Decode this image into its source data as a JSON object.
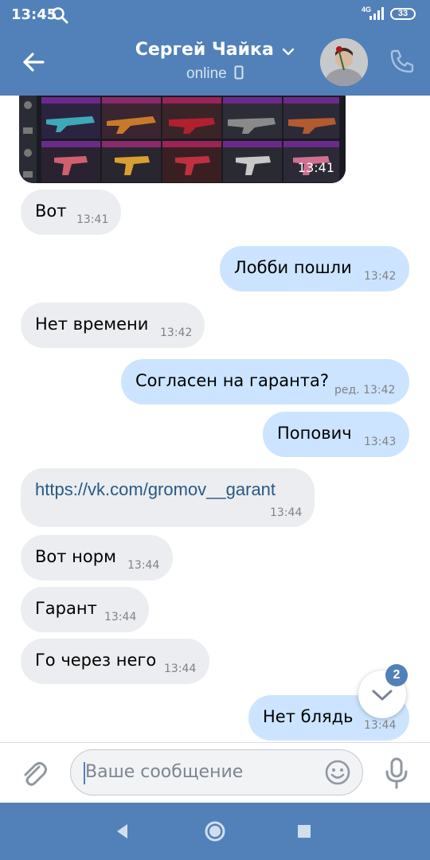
{
  "status_bar": {
    "time": "13:45",
    "network": "4G",
    "battery": "33"
  },
  "header": {
    "title": "Сергей Чайка",
    "subtitle": "online"
  },
  "image_message": {
    "time": "13:41"
  },
  "messages": [
    {
      "text": "Вот",
      "time": "13:41",
      "direction": "incoming"
    },
    {
      "text": "Лобби пошли",
      "time": "13:42",
      "direction": "outgoing"
    },
    {
      "text": "Нет времени",
      "time": "13:42",
      "direction": "incoming"
    },
    {
      "text": "Согласен на гаранта?",
      "time": "ред. 13:42",
      "direction": "outgoing"
    },
    {
      "text": "Попович",
      "time": "13:43",
      "direction": "outgoing"
    },
    {
      "text": "https://vk.com/gromov__garant",
      "time": "13:44",
      "direction": "incoming",
      "link": true
    },
    {
      "text": "Вот норм",
      "time": "13:44",
      "direction": "incoming"
    },
    {
      "text": "Гарант",
      "time": "13:44",
      "direction": "incoming"
    },
    {
      "text": "Го через него",
      "time": "13:44",
      "direction": "incoming"
    },
    {
      "text": "Нет блядь",
      "time": "13:44",
      "direction": "outgoing"
    }
  ],
  "unread_badge": "2",
  "composer": {
    "placeholder": "Ваше сообщение"
  },
  "colors": {
    "brand": "#5181b8",
    "incoming_bubble": "#ebedf0",
    "outgoing_bubble": "#cce4ff",
    "link": "#2a5885"
  },
  "icons": [
    "search-icon",
    "back-arrow-icon",
    "chevron-down-icon",
    "phone-icon",
    "paperclip-icon",
    "smile-icon",
    "microphone-icon",
    "nav-back-icon",
    "nav-home-icon",
    "nav-recents-icon",
    "chevron-down-icon"
  ]
}
